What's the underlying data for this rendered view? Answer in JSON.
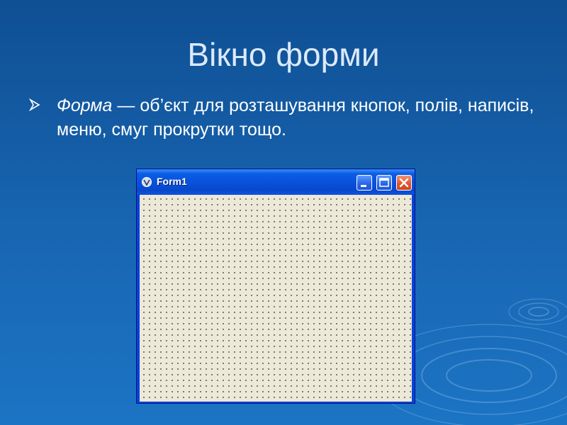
{
  "slide": {
    "title": "Вікно форми",
    "bullet": {
      "icon": "arrow-bullet-icon",
      "term": "Форма",
      "text": " — об’єкт для розташування кнопок, полів, написів, меню, смуг прокрутки тощо."
    }
  },
  "form_window": {
    "title": "Form1",
    "icon": "vb-form-icon",
    "buttons": {
      "minimize": "minimize-icon",
      "maximize": "maximize-icon",
      "close": "close-icon"
    }
  },
  "colors": {
    "background": "#1566b1",
    "title_text": "#dbeafb",
    "window_frame": "#0842d6",
    "client_area": "#ece9d8",
    "close_button": "#e0532c"
  }
}
